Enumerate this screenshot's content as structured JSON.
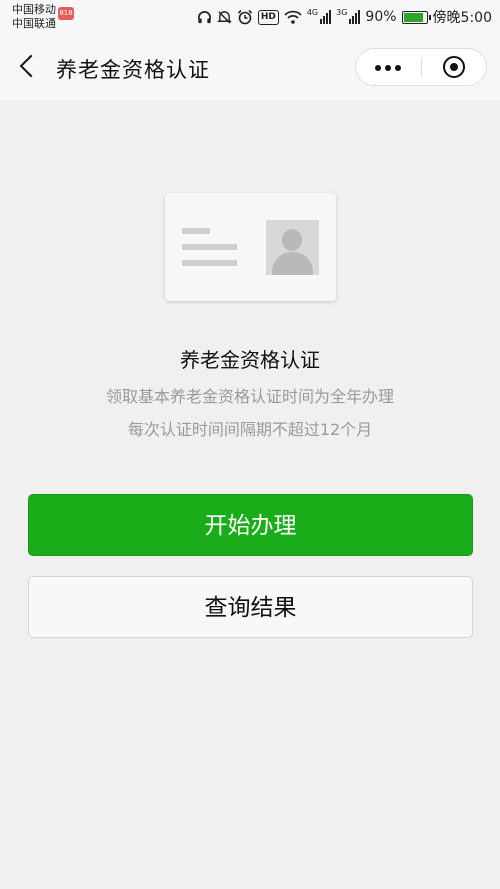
{
  "status_bar": {
    "carrier_1": "中国移动",
    "carrier_2": "中国联通",
    "carrier_badge": "818",
    "hd": "HD",
    "network_1": "4G",
    "network_2": "3G",
    "battery_percent": "90%",
    "battery_level": 0.9,
    "time": "傍晚5:00",
    "icons": [
      "headphones-icon",
      "mute-icon",
      "alarm-icon",
      "hd-icon",
      "wifi-icon",
      "signal-icon",
      "signal-icon",
      "battery-icon"
    ]
  },
  "nav": {
    "title": "养老金资格认证",
    "back_icon": "chevron-left-icon",
    "more_icon": "more-dots-icon",
    "close_icon": "target-close-icon"
  },
  "main": {
    "title": "养老金资格认证",
    "desc_line1": "领取基本养老金资格认证时间为全年办理",
    "desc_line2": "每次认证时间间隔期不超过12个月",
    "primary_button": "开始办理",
    "secondary_button": "查询结果"
  },
  "colors": {
    "primary_green": "#1aad19",
    "background": "#f0f0f0",
    "text_gray": "#9a9a9a"
  }
}
